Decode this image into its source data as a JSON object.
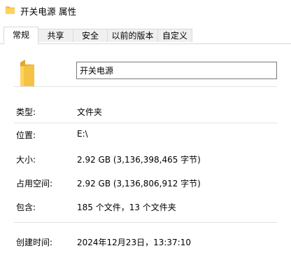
{
  "window": {
    "title": "开关电源 属性"
  },
  "tabs": [
    {
      "label": "常规",
      "active": true
    },
    {
      "label": "共享",
      "active": false
    },
    {
      "label": "安全",
      "active": false
    },
    {
      "label": "以前的版本",
      "active": false
    },
    {
      "label": "自定义",
      "active": false
    }
  ],
  "general": {
    "folder_name": "开关电源",
    "rows": {
      "type": {
        "label": "类型:",
        "value": "文件夹"
      },
      "location": {
        "label": "位置:",
        "value": "E:\\"
      },
      "size": {
        "label": "大小:",
        "value": "2.92 GB (3,136,398,465 字节)"
      },
      "size_on_disk": {
        "label": "占用空间:",
        "value": "2.92 GB (3,136,806,912 字节)"
      },
      "contains": {
        "label": "包含:",
        "value": "185 个文件，13 个文件夹"
      },
      "created": {
        "label": "创建时间:",
        "value": "2024年12月23日，13:37:10"
      }
    }
  },
  "icons": {
    "title_icon": "folder-icon",
    "main_icon": "folder-icon",
    "folder_color": "#f5c243",
    "folder_shade": "#e0a82b"
  },
  "colors": {
    "tab_border": "#d9d9d9",
    "tab_inactive_bg": "#f0f0f0",
    "separator": "#e3e3e3"
  }
}
